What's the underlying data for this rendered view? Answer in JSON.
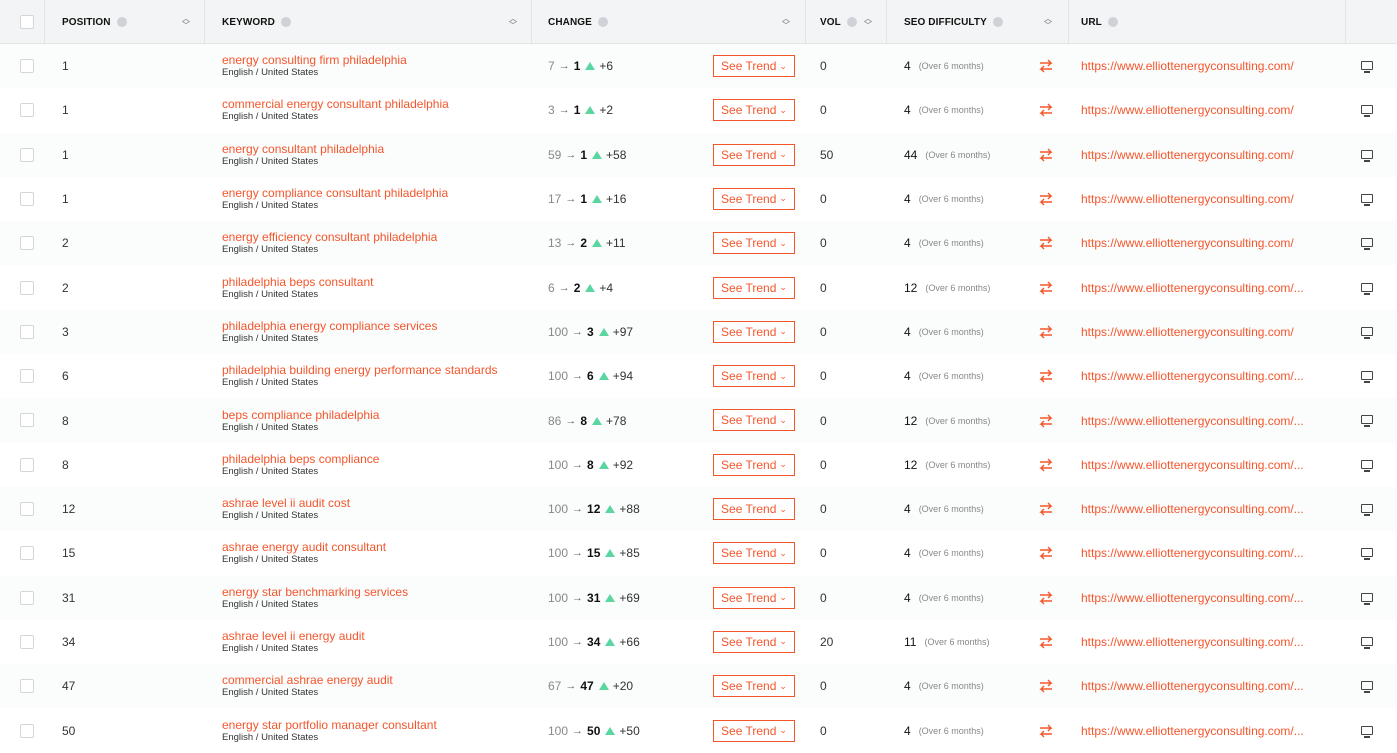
{
  "columns": {
    "position": "POSITION",
    "keyword": "KEYWORD",
    "change": "CHANGE",
    "vol": "VOL",
    "seo_difficulty": "SEO DIFFICULTY",
    "url": "URL"
  },
  "see_trend_label": "See Trend",
  "chevron": "⌄",
  "arrow": "→",
  "rows": [
    {
      "position": "1",
      "keyword": "energy consulting firm philadelphia",
      "locale": "English / United States",
      "from": "7",
      "to": "1",
      "delta": "+6",
      "vol": "0",
      "seo": "4",
      "seo_note": "(Over 6 months)",
      "url": "https://www.elliottenergyconsulting.com/"
    },
    {
      "position": "1",
      "keyword": "commercial energy consultant philadelphia",
      "locale": "English / United States",
      "from": "3",
      "to": "1",
      "delta": "+2",
      "vol": "0",
      "seo": "4",
      "seo_note": "(Over 6 months)",
      "url": "https://www.elliottenergyconsulting.com/"
    },
    {
      "position": "1",
      "keyword": "energy consultant philadelphia",
      "locale": "English / United States",
      "from": "59",
      "to": "1",
      "delta": "+58",
      "vol": "50",
      "seo": "44",
      "seo_note": "(Over 6 months)",
      "url": "https://www.elliottenergyconsulting.com/"
    },
    {
      "position": "1",
      "keyword": "energy compliance consultant philadelphia",
      "locale": "English / United States",
      "from": "17",
      "to": "1",
      "delta": "+16",
      "vol": "0",
      "seo": "4",
      "seo_note": "(Over 6 months)",
      "url": "https://www.elliottenergyconsulting.com/"
    },
    {
      "position": "2",
      "keyword": "energy efficiency consultant philadelphia",
      "locale": "English / United States",
      "from": "13",
      "to": "2",
      "delta": "+11",
      "vol": "0",
      "seo": "4",
      "seo_note": "(Over 6 months)",
      "url": "https://www.elliottenergyconsulting.com/"
    },
    {
      "position": "2",
      "keyword": "philadelphia beps consultant",
      "locale": "English / United States",
      "from": "6",
      "to": "2",
      "delta": "+4",
      "vol": "0",
      "seo": "12",
      "seo_note": "(Over 6 months)",
      "url": "https://www.elliottenergyconsulting.com/..."
    },
    {
      "position": "3",
      "keyword": "philadelphia energy compliance services",
      "locale": "English / United States",
      "from": "100",
      "to": "3",
      "delta": "+97",
      "vol": "0",
      "seo": "4",
      "seo_note": "(Over 6 months)",
      "url": "https://www.elliottenergyconsulting.com/"
    },
    {
      "position": "6",
      "keyword": "philadelphia building energy performance standards",
      "locale": "English / United States",
      "from": "100",
      "to": "6",
      "delta": "+94",
      "vol": "0",
      "seo": "4",
      "seo_note": "(Over 6 months)",
      "url": "https://www.elliottenergyconsulting.com/..."
    },
    {
      "position": "8",
      "keyword": "beps compliance philadelphia",
      "locale": "English / United States",
      "from": "86",
      "to": "8",
      "delta": "+78",
      "vol": "0",
      "seo": "12",
      "seo_note": "(Over 6 months)",
      "url": "https://www.elliottenergyconsulting.com/..."
    },
    {
      "position": "8",
      "keyword": "philadelphia beps compliance",
      "locale": "English / United States",
      "from": "100",
      "to": "8",
      "delta": "+92",
      "vol": "0",
      "seo": "12",
      "seo_note": "(Over 6 months)",
      "url": "https://www.elliottenergyconsulting.com/..."
    },
    {
      "position": "12",
      "keyword": "ashrae level ii audit cost",
      "locale": "English / United States",
      "from": "100",
      "to": "12",
      "delta": "+88",
      "vol": "0",
      "seo": "4",
      "seo_note": "(Over 6 months)",
      "url": "https://www.elliottenergyconsulting.com/..."
    },
    {
      "position": "15",
      "keyword": "ashrae energy audit consultant",
      "locale": "English / United States",
      "from": "100",
      "to": "15",
      "delta": "+85",
      "vol": "0",
      "seo": "4",
      "seo_note": "(Over 6 months)",
      "url": "https://www.elliottenergyconsulting.com/..."
    },
    {
      "position": "31",
      "keyword": "energy star benchmarking services",
      "locale": "English / United States",
      "from": "100",
      "to": "31",
      "delta": "+69",
      "vol": "0",
      "seo": "4",
      "seo_note": "(Over 6 months)",
      "url": "https://www.elliottenergyconsulting.com/..."
    },
    {
      "position": "34",
      "keyword": "ashrae level ii energy audit",
      "locale": "English / United States",
      "from": "100",
      "to": "34",
      "delta": "+66",
      "vol": "20",
      "seo": "11",
      "seo_note": "(Over 6 months)",
      "url": "https://www.elliottenergyconsulting.com/..."
    },
    {
      "position": "47",
      "keyword": "commercial ashrae energy audit",
      "locale": "English / United States",
      "from": "67",
      "to": "47",
      "delta": "+20",
      "vol": "0",
      "seo": "4",
      "seo_note": "(Over 6 months)",
      "url": "https://www.elliottenergyconsulting.com/..."
    },
    {
      "position": "50",
      "keyword": "energy star portfolio manager consultant",
      "locale": "English / United States",
      "from": "100",
      "to": "50",
      "delta": "+50",
      "vol": "0",
      "seo": "4",
      "seo_note": "(Over 6 months)",
      "url": "https://www.elliottenergyconsulting.com/..."
    }
  ],
  "icons": {
    "help": "help-circle-icon",
    "sort": "sort-arrows-icon",
    "swap": "swap-arrows-icon",
    "monitor": "desktop-monitor-icon",
    "trend_up": "triangle-up-icon"
  },
  "colors": {
    "accent": "#f4562c",
    "up": "#5bd6a0",
    "header_bg": "#f3f4f5"
  }
}
